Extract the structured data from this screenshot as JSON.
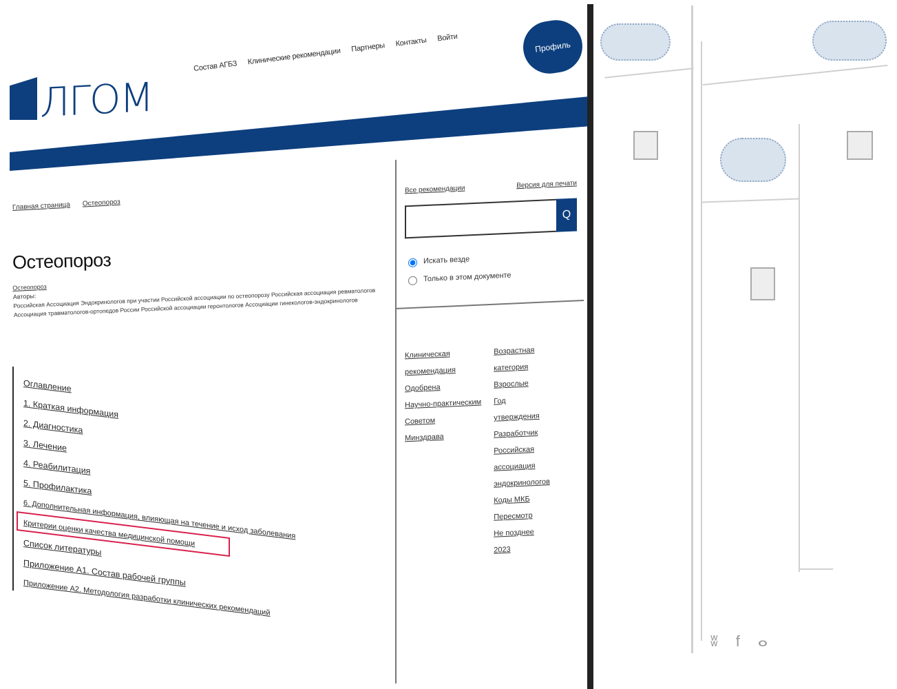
{
  "brand": {
    "logo_text": "ЛГОМ"
  },
  "topnav": {
    "items": [
      "Состав АГБЗ",
      "Клинические рекомендации",
      "Партнеры",
      "Контакты",
      "Войти"
    ],
    "cta": "Профиль"
  },
  "breadcrumb": [
    "Главная страница",
    "Остеопороз"
  ],
  "page": {
    "title": "Остеопороз",
    "tag": "Остеопороз",
    "meta_label": "Авторы:",
    "meta_text": "Российская Ассоциация Эндокринологов при участии Российской ассоциации по остеопорозу Российская ассоциация ревматологов Ассоциация травматологов-ортопедов России Российской ассоциации геронтологов Ассоциации гинекологов-эндокринологов"
  },
  "toc": [
    "Оглавление",
    "1. Краткая информация",
    "2. Диагностика",
    "3. Лечение",
    "4. Реабилитация",
    "5. Профилактика",
    "6. Дополнительная информация, влияющая на течение и исход заболевания",
    "Критерии оценки качества медицинской помощи",
    "Список литературы",
    "Приложение А1. Состав рабочей группы",
    "Приложение А2. Методология разработки клинических рекомендаций"
  ],
  "sidebar": {
    "back_link": "Все рекомендации",
    "print_link": "Версия для печати",
    "search_placeholder": "",
    "search_button": "Q",
    "radio_1": "Искать везде",
    "radio_2": "Только в этом документе",
    "col1": [
      "Клиническая",
      "рекомендация",
      "Одобрена",
      "Научно-практическим",
      "Советом",
      "Минздрава"
    ],
    "col2": [
      "Возрастная",
      "категория",
      "Взрослые",
      "Год",
      "утверждения",
      "Разработчик",
      "Российская",
      "ассоциация",
      "эндокринологов",
      "Коды МКБ",
      "Пересмотр",
      "Не позднее",
      "2023"
    ]
  },
  "colors": {
    "brand_blue": "#0d3f7e",
    "highlight": "#d8204c"
  },
  "icons": [
    "search-icon",
    "vk-icon",
    "facebook-icon",
    "odnoklassniki-icon"
  ]
}
